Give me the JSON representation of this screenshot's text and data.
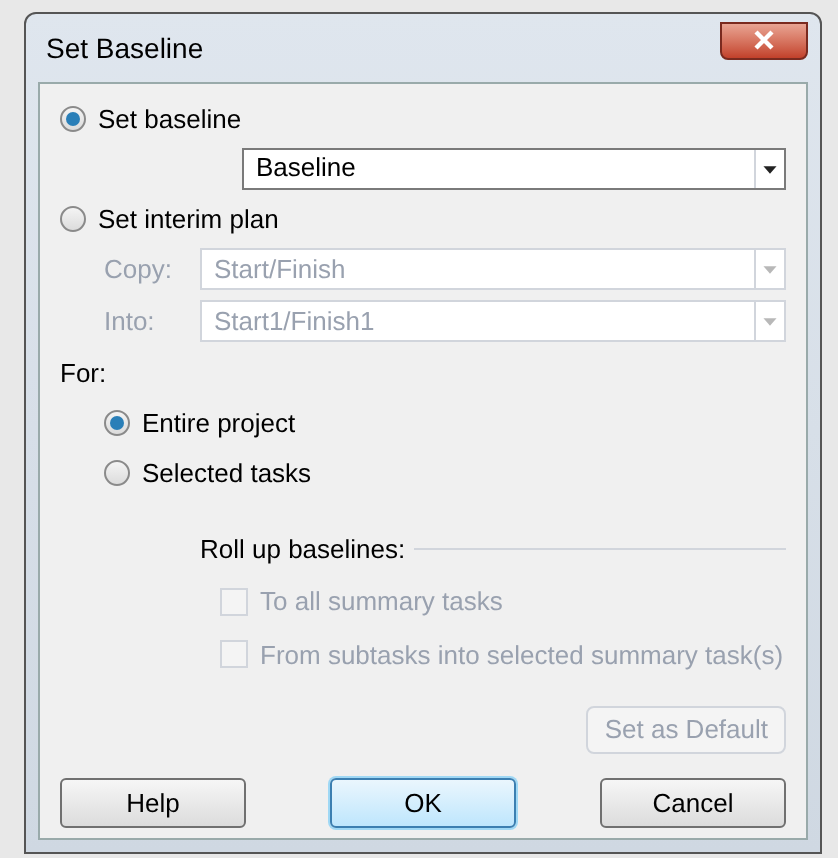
{
  "window": {
    "title": "Set Baseline"
  },
  "baseline_option": {
    "label": "Set baseline",
    "selected": true,
    "value": "Baseline"
  },
  "interim_option": {
    "label": "Set interim plan",
    "selected": false
  },
  "interim_fields": [
    {
      "label": "Copy:",
      "value": "Start/Finish",
      "disabled": true
    },
    {
      "label": "Into:",
      "value": "Start1/Finish1",
      "disabled": true
    }
  ],
  "for_label": "For:",
  "scope": [
    {
      "label": "Entire project",
      "selected": true
    },
    {
      "label": "Selected tasks",
      "selected": false
    }
  ],
  "rollup": {
    "title": "Roll up baselines:",
    "options": [
      {
        "label": "To all summary tasks",
        "checked": false,
        "disabled": true
      },
      {
        "label": "From subtasks into selected summary task(s)",
        "checked": false,
        "disabled": true
      }
    ]
  },
  "set_default": {
    "label": "Set as Default",
    "disabled": true
  },
  "buttons": [
    {
      "label": "Help",
      "kind": "normal"
    },
    {
      "label": "OK",
      "kind": "default"
    },
    {
      "label": "Cancel",
      "kind": "normal"
    }
  ]
}
